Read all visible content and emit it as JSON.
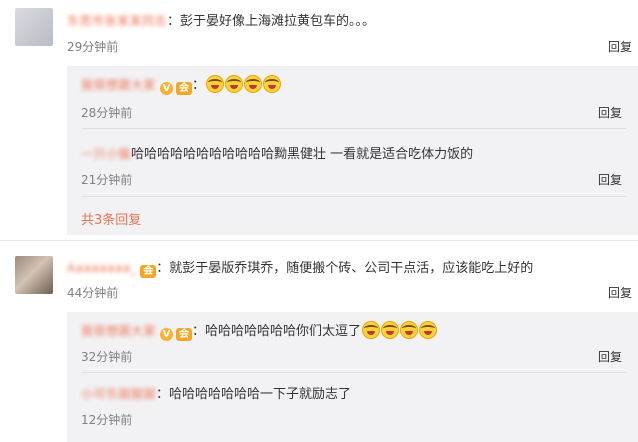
{
  "comments": [
    {
      "user": "东莞市张某某同志",
      "text": "：彭于晏好像上海滩拉黄包车的。。。",
      "time": "29分钟前",
      "reply_label": "回复",
      "replies": [
        {
          "user": "我很想跟大家",
          "text": "：",
          "emoji_count": 4,
          "emoji_name": "laughing-tears-emoji",
          "time": "28分钟前",
          "reply_label": "回复"
        },
        {
          "user": "一只小猫",
          "text": "哈哈哈哈哈哈哈哈哈哈哈黝黑健壮 一看就是适合吃体力饭的",
          "time": "21分钟前",
          "reply_label": "回复"
        }
      ],
      "more_replies": "共3条回复"
    },
    {
      "user": "Aaaaaaaa_",
      "text": "：就彭于晏版乔琪乔，随便搬个砖、公司干点活，应该能吃上好的",
      "time": "44分钟前",
      "reply_label": "回复",
      "replies": [
        {
          "user": "我很想跟大家",
          "text": "：哈哈哈哈哈哈哈你们太逗了",
          "emoji_count": 4,
          "emoji_name": "laughing-tears-emoji",
          "time": "32分钟前",
          "reply_label": "回复"
        },
        {
          "user": "小可乐甜甜甜",
          "text": "：哈哈哈哈哈哈哈一下子就励志了",
          "time": "12分钟前",
          "reply_label": "回复"
        }
      ]
    }
  ],
  "badges": {
    "v": "V",
    "member": "会"
  },
  "colors": {
    "username": "#eb7350",
    "reply_box": "#f2f2f5",
    "meta": "#808080"
  }
}
